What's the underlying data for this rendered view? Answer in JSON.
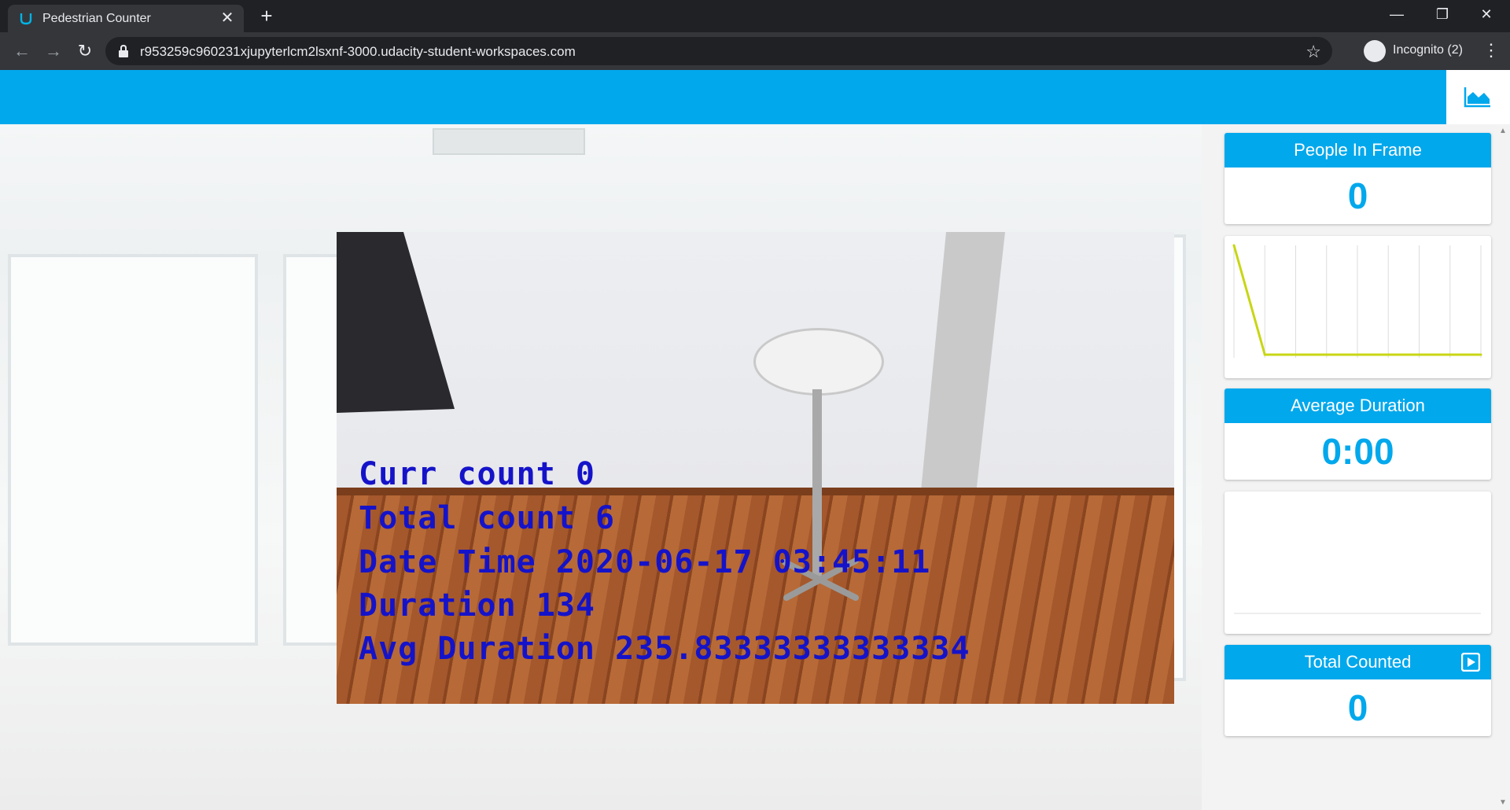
{
  "browser": {
    "tab_title": "Pedestrian Counter",
    "url": "r953259c960231xjupyterlcm2lsxnf-3000.udacity-student-workspaces.com",
    "incognito_label": "Incognito (2)"
  },
  "video_overlay": {
    "curr_count": "Curr count 0",
    "total_count": "Total count 6",
    "date_time": "Date Time 2020-06-17 03:45:11",
    "duration": "Duration 134",
    "avg_duration": "Avg Duration 235.83333333333334"
  },
  "stats": {
    "people_in_frame_label": "People In Frame",
    "people_in_frame_value": "0",
    "average_duration_label": "Average Duration",
    "average_duration_value": "0:00",
    "total_counted_label": "Total Counted",
    "total_counted_value": "0"
  },
  "people_chart": {
    "type": "line",
    "values": [
      1,
      0,
      0,
      0,
      0,
      0,
      0,
      0,
      0
    ],
    "line_color": "#c8d614",
    "ylim": [
      0,
      1
    ]
  },
  "colors": {
    "accent": "#02a8ec",
    "overlay_text": "#1513c9"
  },
  "icons": {
    "header": "area-chart-icon",
    "total_counted": "play-icon"
  }
}
